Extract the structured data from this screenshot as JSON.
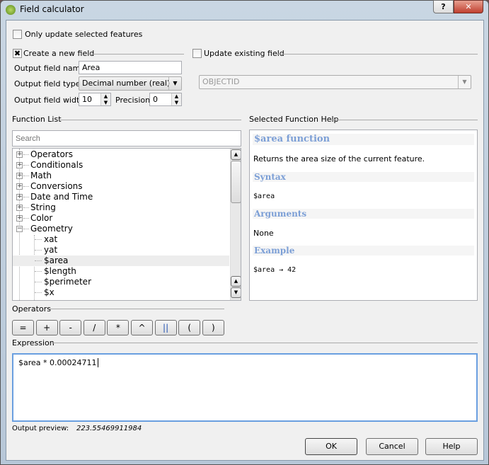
{
  "window": {
    "title": "Field calculator",
    "help_button": "?",
    "close_button": "✕"
  },
  "only_selected": {
    "label": "Only update selected features",
    "checked": false
  },
  "create_field": {
    "label": "Create a new field",
    "checked": true,
    "name_label": "Output field name",
    "name_value": "Area",
    "type_label": "Output field type",
    "type_value": "Decimal number (real)",
    "width_label": "Output field width",
    "width_value": "10",
    "precision_label": "Precision",
    "precision_value": "0"
  },
  "update_field": {
    "label": "Update existing field",
    "checked": false,
    "field_value": "OBJECTID"
  },
  "function_list": {
    "label": "Function List",
    "search_placeholder": "Search",
    "groups": [
      "Operators",
      "Conditionals",
      "Math",
      "Conversions",
      "Date and Time",
      "String",
      "Color",
      "Geometry"
    ],
    "geometry_items": [
      "xat",
      "yat",
      "$area",
      "$length",
      "$perimeter",
      "$x"
    ],
    "selected": "$area"
  },
  "help": {
    "label": "Selected Function Help",
    "title": "$area function",
    "description": "Returns the area size of the current feature.",
    "syntax_heading": "Syntax",
    "syntax": "$area",
    "arguments_heading": "Arguments",
    "arguments": "None",
    "example_heading": "Example",
    "example": "$area → 42",
    "heading_color": "#7c9fd6"
  },
  "operators": {
    "label": "Operators",
    "buttons": [
      "=",
      "+",
      "-",
      "/",
      "*",
      "^",
      "||",
      "(",
      ")"
    ]
  },
  "expression": {
    "label": "Expression",
    "value": "$area * 0.00024711"
  },
  "preview": {
    "label": "Output preview:",
    "value": "223.55469911984"
  },
  "footer": {
    "ok": "OK",
    "cancel": "Cancel",
    "help": "Help"
  }
}
